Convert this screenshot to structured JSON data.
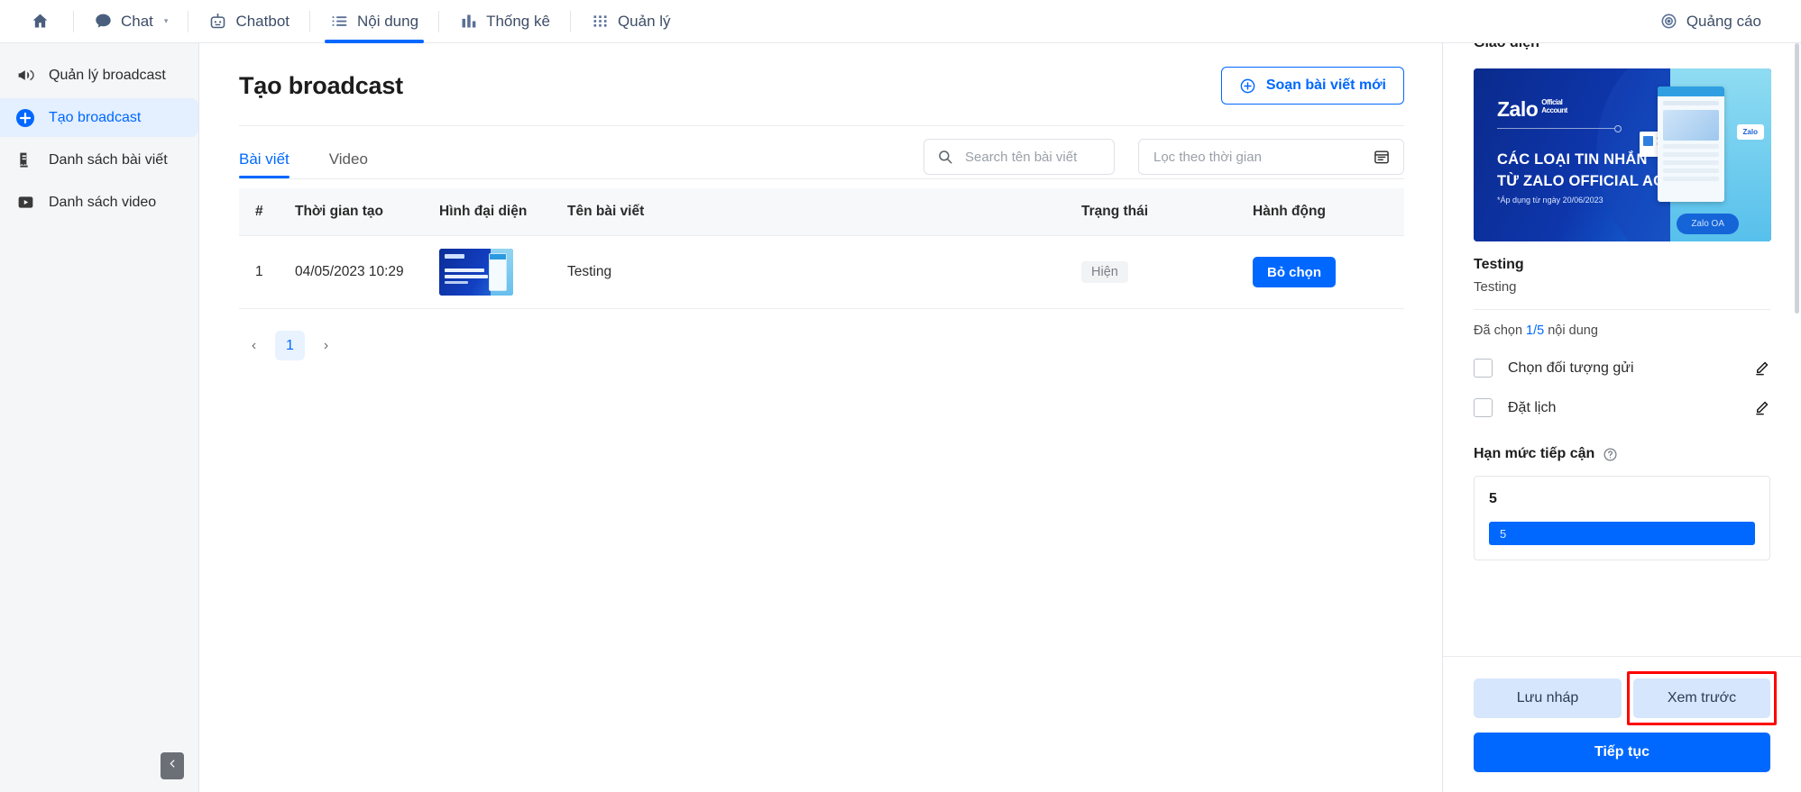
{
  "topnav": {
    "items": [
      {
        "label": "",
        "icon": "home-icon",
        "name": "home"
      },
      {
        "label": "Chat",
        "icon": "chat-icon",
        "name": "chat",
        "caret": "▾"
      },
      {
        "label": "Chatbot",
        "icon": "robot-icon",
        "name": "chatbot"
      },
      {
        "label": "Nội dung",
        "icon": "list-icon",
        "name": "noi-dung",
        "active": true
      },
      {
        "label": "Thống kê",
        "icon": "bar-chart-icon",
        "name": "thong-ke"
      },
      {
        "label": "Quản lý",
        "icon": "grid-dots-icon",
        "name": "quan-ly"
      }
    ],
    "right": {
      "label": "Quảng cáo",
      "icon": "target-icon"
    }
  },
  "sidebar": {
    "items": [
      {
        "label": "Quản lý broadcast",
        "icon": "megaphone-icon",
        "active": false
      },
      {
        "label": "Tạo broadcast",
        "icon": "plus-circle-icon",
        "active": true
      },
      {
        "label": "Danh sách bài viết",
        "icon": "receipt-icon",
        "active": false
      },
      {
        "label": "Danh sách video",
        "icon": "play-icon",
        "active": false
      }
    ],
    "collapse_icon": "chevron-left-icon"
  },
  "main": {
    "title": "Tạo broadcast",
    "compose_button": {
      "label": "Soạn bài viết mới",
      "icon": "plus-circle-outline-icon"
    },
    "tabs": [
      {
        "label": "Bài viết",
        "active": true
      },
      {
        "label": "Video",
        "active": false
      }
    ],
    "search": {
      "placeholder": "Search tên bài viết",
      "value": "",
      "icon": "search-icon"
    },
    "date_filter": {
      "placeholder": "Lọc theo thời gian",
      "value": "",
      "icon": "calendar-icon"
    },
    "table": {
      "columns": [
        "#",
        "Thời gian tạo",
        "Hình đại diện",
        "Tên bài viết",
        "Trạng thái",
        "Hành động"
      ],
      "rows": [
        {
          "index": "1",
          "created_at": "04/05/2023 10:29",
          "thumbnail": "zalo-oa-banner-thumb",
          "name": "Testing",
          "status": "Hiện",
          "action": "Bỏ chọn"
        }
      ]
    },
    "pagination": {
      "prev": "‹",
      "pages": [
        "1"
      ],
      "current": "1",
      "next": "›"
    }
  },
  "right_panel": {
    "section_heading": "Giao diện",
    "preview": {
      "brand": "Zalo",
      "brand_sub_line1": "Official",
      "brand_sub_line2": "Account",
      "headline_line1": "CÁC LOẠI TIN NHẮN",
      "headline_line2": "TỪ ZALO OFFICIAL ACCOUNT",
      "note": "*Áp dụng từ ngày 20/06/2023",
      "bubble": "Zalo",
      "oa_tag": "Zalo OA"
    },
    "title": "Testing",
    "subtitle": "Testing",
    "selected_prefix": "Đã chọn ",
    "selected_count": "1/5",
    "selected_suffix": " nội dung",
    "checkboxes": [
      {
        "label": "Chọn đối tượng gửi",
        "checked": false,
        "edit_icon": "pencil-icon"
      },
      {
        "label": "Đặt lịch",
        "checked": false,
        "edit_icon": "pencil-icon"
      }
    ],
    "limit": {
      "heading": "Hạn mức tiếp cận",
      "help_icon": "question-circle-icon",
      "value": "5",
      "bar_label": "5"
    },
    "footer": {
      "save_draft": "Lưu nháp",
      "preview": "Xem trước",
      "continue": "Tiếp tục",
      "highlight_color": "#ff0000"
    }
  },
  "colors": {
    "accent": "#0068ff",
    "sidebar_bg": "#f5f6f7",
    "active_item_bg": "#e4efff",
    "badge_bg": "#f2f3f5"
  }
}
